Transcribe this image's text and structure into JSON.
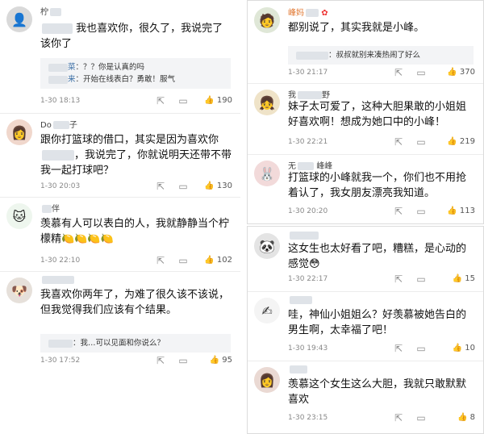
{
  "left": [
    {
      "name": "柠",
      "text": "我也喜欢你，很久了，我说完了该你了",
      "replies": [
        {
          "name": "菜",
          "text": "：？？你是认真的吗"
        },
        {
          "name": "来",
          "text": "：开始在线表白？勇敢！服气"
        }
      ],
      "time": "1-30 18:13",
      "likes": "190"
    },
    {
      "name": "Do",
      "name_suffix": "子",
      "text": "跟你",
      "text_rest": "打篮球的借口，其实是因为喜欢你",
      "text_tail": "，我说完了，你就说明天还带不带我一起打球吧？",
      "time": "1-30 20:03",
      "likes": "130"
    },
    {
      "name": "伴",
      "text": "羡慕有人可以表白的人，我就静静当个柠檬精",
      "emoji": "🍋🍋🍋🍋",
      "time": "1-30 22:10",
      "likes": "102"
    },
    {
      "name": "",
      "text": "我喜欢你两年了，为难了很久该不该说，但我觉得我们应该有个结果。",
      "replies": [
        {
          "name": "",
          "text": "：我…可以见面和你说么？"
        }
      ],
      "time": "1-30 17:52",
      "likes": "95"
    }
  ],
  "right_top": [
    {
      "name": "峰妈",
      "text": "都别说了，其实我就是小峰。",
      "replies": [
        {
          "name": "",
          "text": "：叔叔就别来凑热闹了好么"
        }
      ],
      "time": "1-30 21:17",
      "likes": "370"
    },
    {
      "name": "我",
      "name_suffix": "野",
      "text": "妹子太可爱了，这种大胆果敢的小姐姐好喜欢啊！想成为她口中的小峰！",
      "time": "1-30 22:21",
      "likes": "219"
    },
    {
      "name": "无",
      "name_suffix": "峰峰",
      "text": "打篮球的小峰就我一个，你们也不用抢着认了，我女朋友漂亮我知道。",
      "time": "1-30 20:20",
      "likes": "113"
    }
  ],
  "right_bottom": [
    {
      "name": "",
      "text": "这女生也太好看了吧，糟糕，是心动的感觉",
      "time": "1-30 22:17",
      "likes": "15"
    },
    {
      "name": "",
      "text": "哇，神仙小姐姐么？好羡慕被她告白的男生啊，太幸福了吧！",
      "time": "1-30 19:43",
      "likes": "10"
    },
    {
      "name": "",
      "text": "羡慕这个女生这么大胆，我就只敢默默喜欢",
      "time": "1-30 23:15",
      "likes": "8"
    }
  ]
}
